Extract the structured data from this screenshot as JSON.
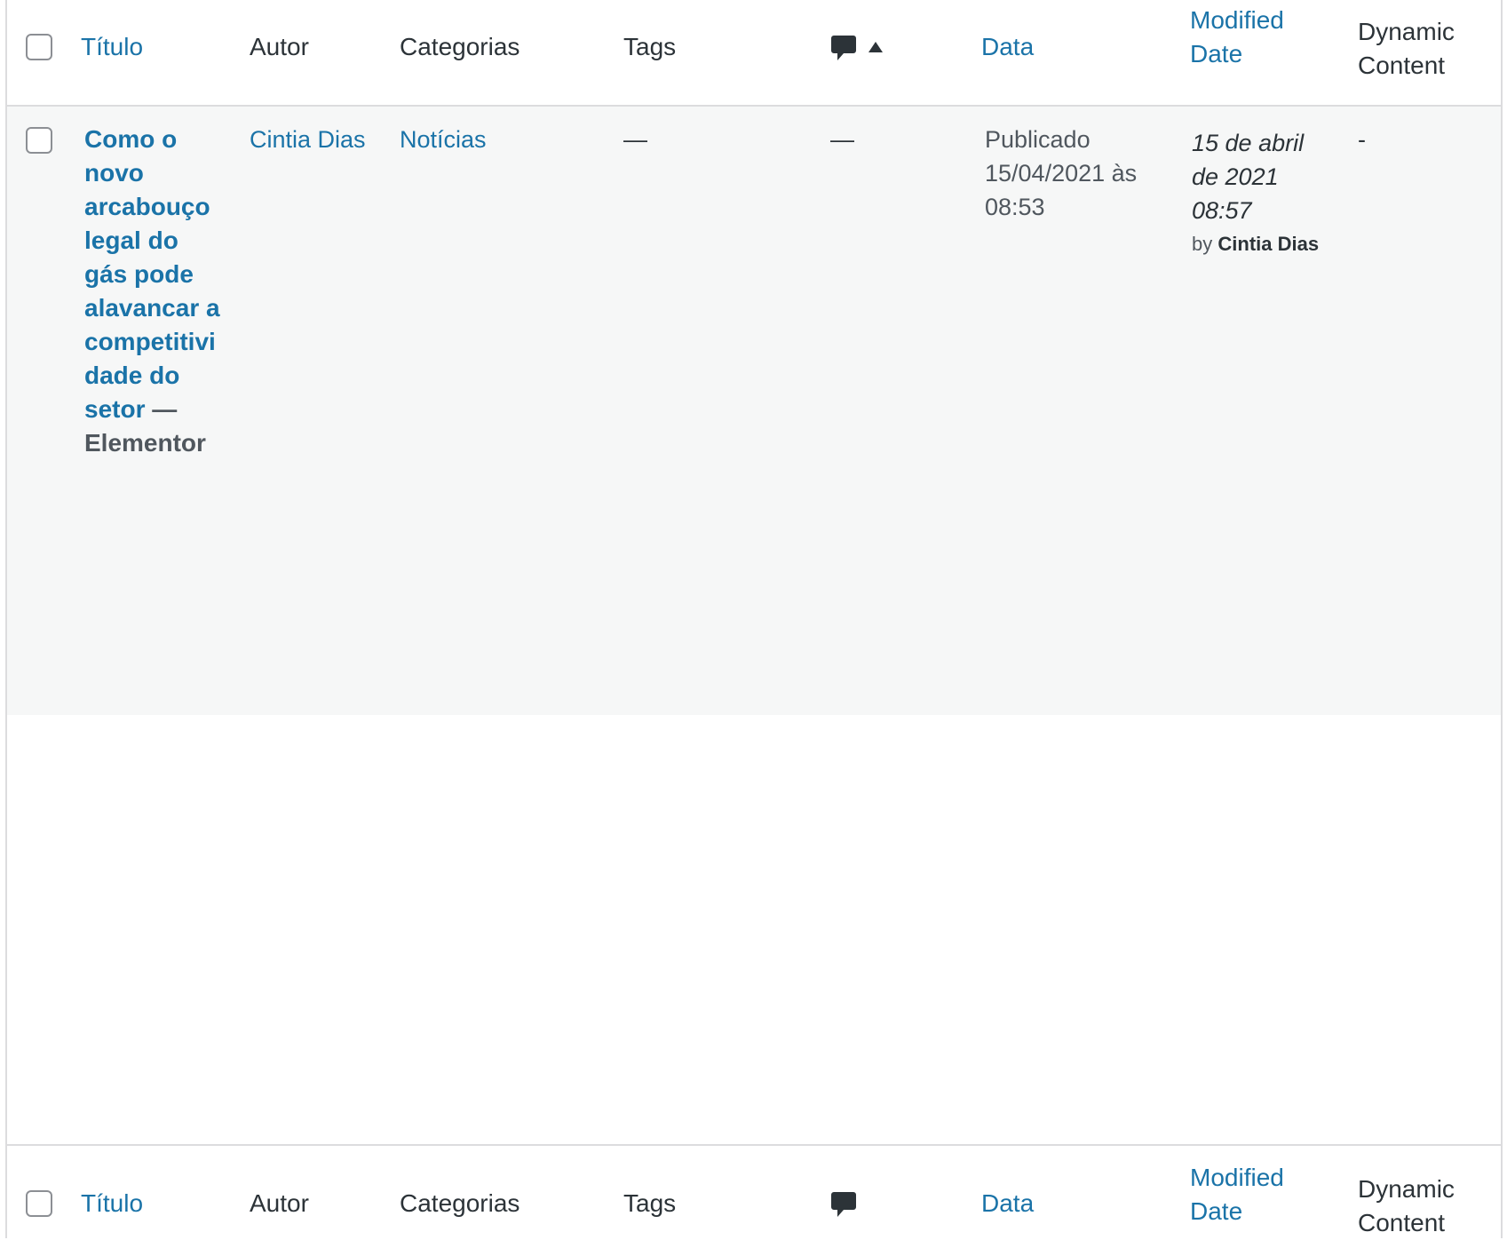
{
  "columns": {
    "title": "Título",
    "author": "Autor",
    "categories": "Categorias",
    "tags": "Tags",
    "comments_icon": "comment-icon",
    "date": "Data",
    "modified_line1": "Modified",
    "modified_line2": "Date",
    "dynamic_line1": "Dynamic",
    "dynamic_line2": "Content"
  },
  "sort": {
    "column": "comments",
    "direction": "ascending",
    "icon": "sort-up-icon"
  },
  "post": {
    "title_lines": [
      "Como o",
      "novo",
      "arcabouço",
      "legal do",
      "gás pode",
      "alavancar a",
      "competitivi",
      "dade do",
      "setor"
    ],
    "dash": " —",
    "state": "Elementor",
    "author": "Cintia Dias",
    "category": "Notícias",
    "tags": "—",
    "comments": "—",
    "date_status": "Publicado",
    "date_value": "15/04/2021 às",
    "date_time": "08:53",
    "modified_line1": "15 de abril",
    "modified_line2": "de 2021",
    "modified_line3": "08:57",
    "modified_by_prefix": "by",
    "modified_by_name": "Cintia Dias",
    "dynamic": "-"
  },
  "colors": {
    "link": "#1a73a8",
    "row_alt": "#f6f7f7",
    "border": "#dcdcde"
  }
}
